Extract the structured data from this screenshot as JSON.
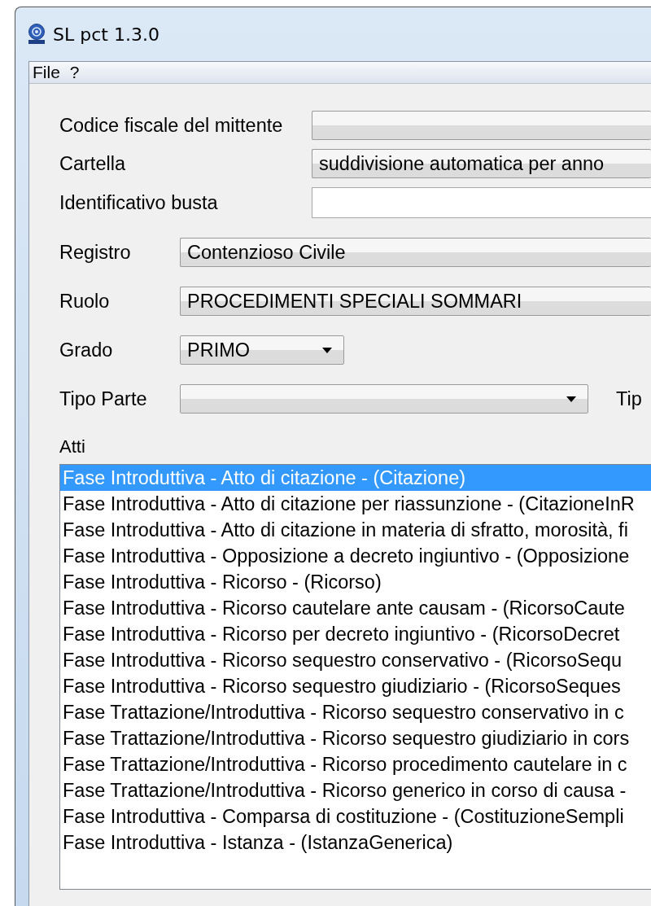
{
  "window": {
    "title": "SL pct 1.3.0"
  },
  "menu": [
    {
      "label": "File"
    },
    {
      "label": "?"
    }
  ],
  "header_fields": [
    {
      "label": "Codice fiscale del mittente",
      "kind": "wide-combo"
    },
    {
      "label": "Cartella",
      "kind": "wide-combo",
      "value": "suddivisione automatica per anno"
    },
    {
      "label": "Identificativo busta",
      "kind": "text"
    }
  ],
  "fields": [
    {
      "label": "Registro",
      "kind": "wide-combo",
      "value": "Contenzioso Civile"
    },
    {
      "label": "Ruolo",
      "kind": "wide-combo",
      "value": "PROCEDIMENTI SPECIALI SOMMARI"
    },
    {
      "label": "Grado",
      "kind": "short-combo",
      "value": "PRIMO"
    },
    {
      "label": "Tipo Parte",
      "kind": "medium-combo",
      "side_label": "Tip"
    }
  ],
  "atti": {
    "label": "Atti",
    "items": [
      {
        "text": "Fase Introduttiva - Atto di citazione - (Citazione)",
        "selected": true
      },
      {
        "text": "Fase Introduttiva - Atto di citazione per riassunzione - (CitazioneInR",
        "selected": false
      },
      {
        "text": "Fase Introduttiva - Atto di citazione in materia di sfratto, morosità, fi",
        "selected": false
      },
      {
        "text": "Fase Introduttiva - Opposizione a decreto ingiuntivo - (Opposizione",
        "selected": false
      },
      {
        "text": "Fase Introduttiva - Ricorso - (Ricorso)",
        "selected": false
      },
      {
        "text": "Fase Introduttiva - Ricorso cautelare ante causam - (RicorsoCaute",
        "selected": false
      },
      {
        "text": "Fase Introduttiva - Ricorso per decreto ingiuntivo - (RicorsoDecret",
        "selected": false
      },
      {
        "text": "Fase Introduttiva - Ricorso sequestro conservativo - (RicorsoSequ",
        "selected": false
      },
      {
        "text": "Fase Introduttiva - Ricorso sequestro giudiziario - (RicorsoSeques",
        "selected": false
      },
      {
        "text": "Fase Trattazione/Introduttiva - Ricorso sequestro conservativo in c",
        "selected": false
      },
      {
        "text": "Fase Trattazione/Introduttiva - Ricorso sequestro giudiziario in cors",
        "selected": false
      },
      {
        "text": "Fase Trattazione/Introduttiva - Ricorso procedimento cautelare in c",
        "selected": false
      },
      {
        "text": "Fase Trattazione/Introduttiva - Ricorso generico in corso di causa -",
        "selected": false
      },
      {
        "text": "Fase Introduttiva - Comparsa di costituzione - (CostituzioneSempli",
        "selected": false
      },
      {
        "text": "Fase Introduttiva - Istanza - (IstanzaGenerica)",
        "selected": false
      }
    ]
  }
}
